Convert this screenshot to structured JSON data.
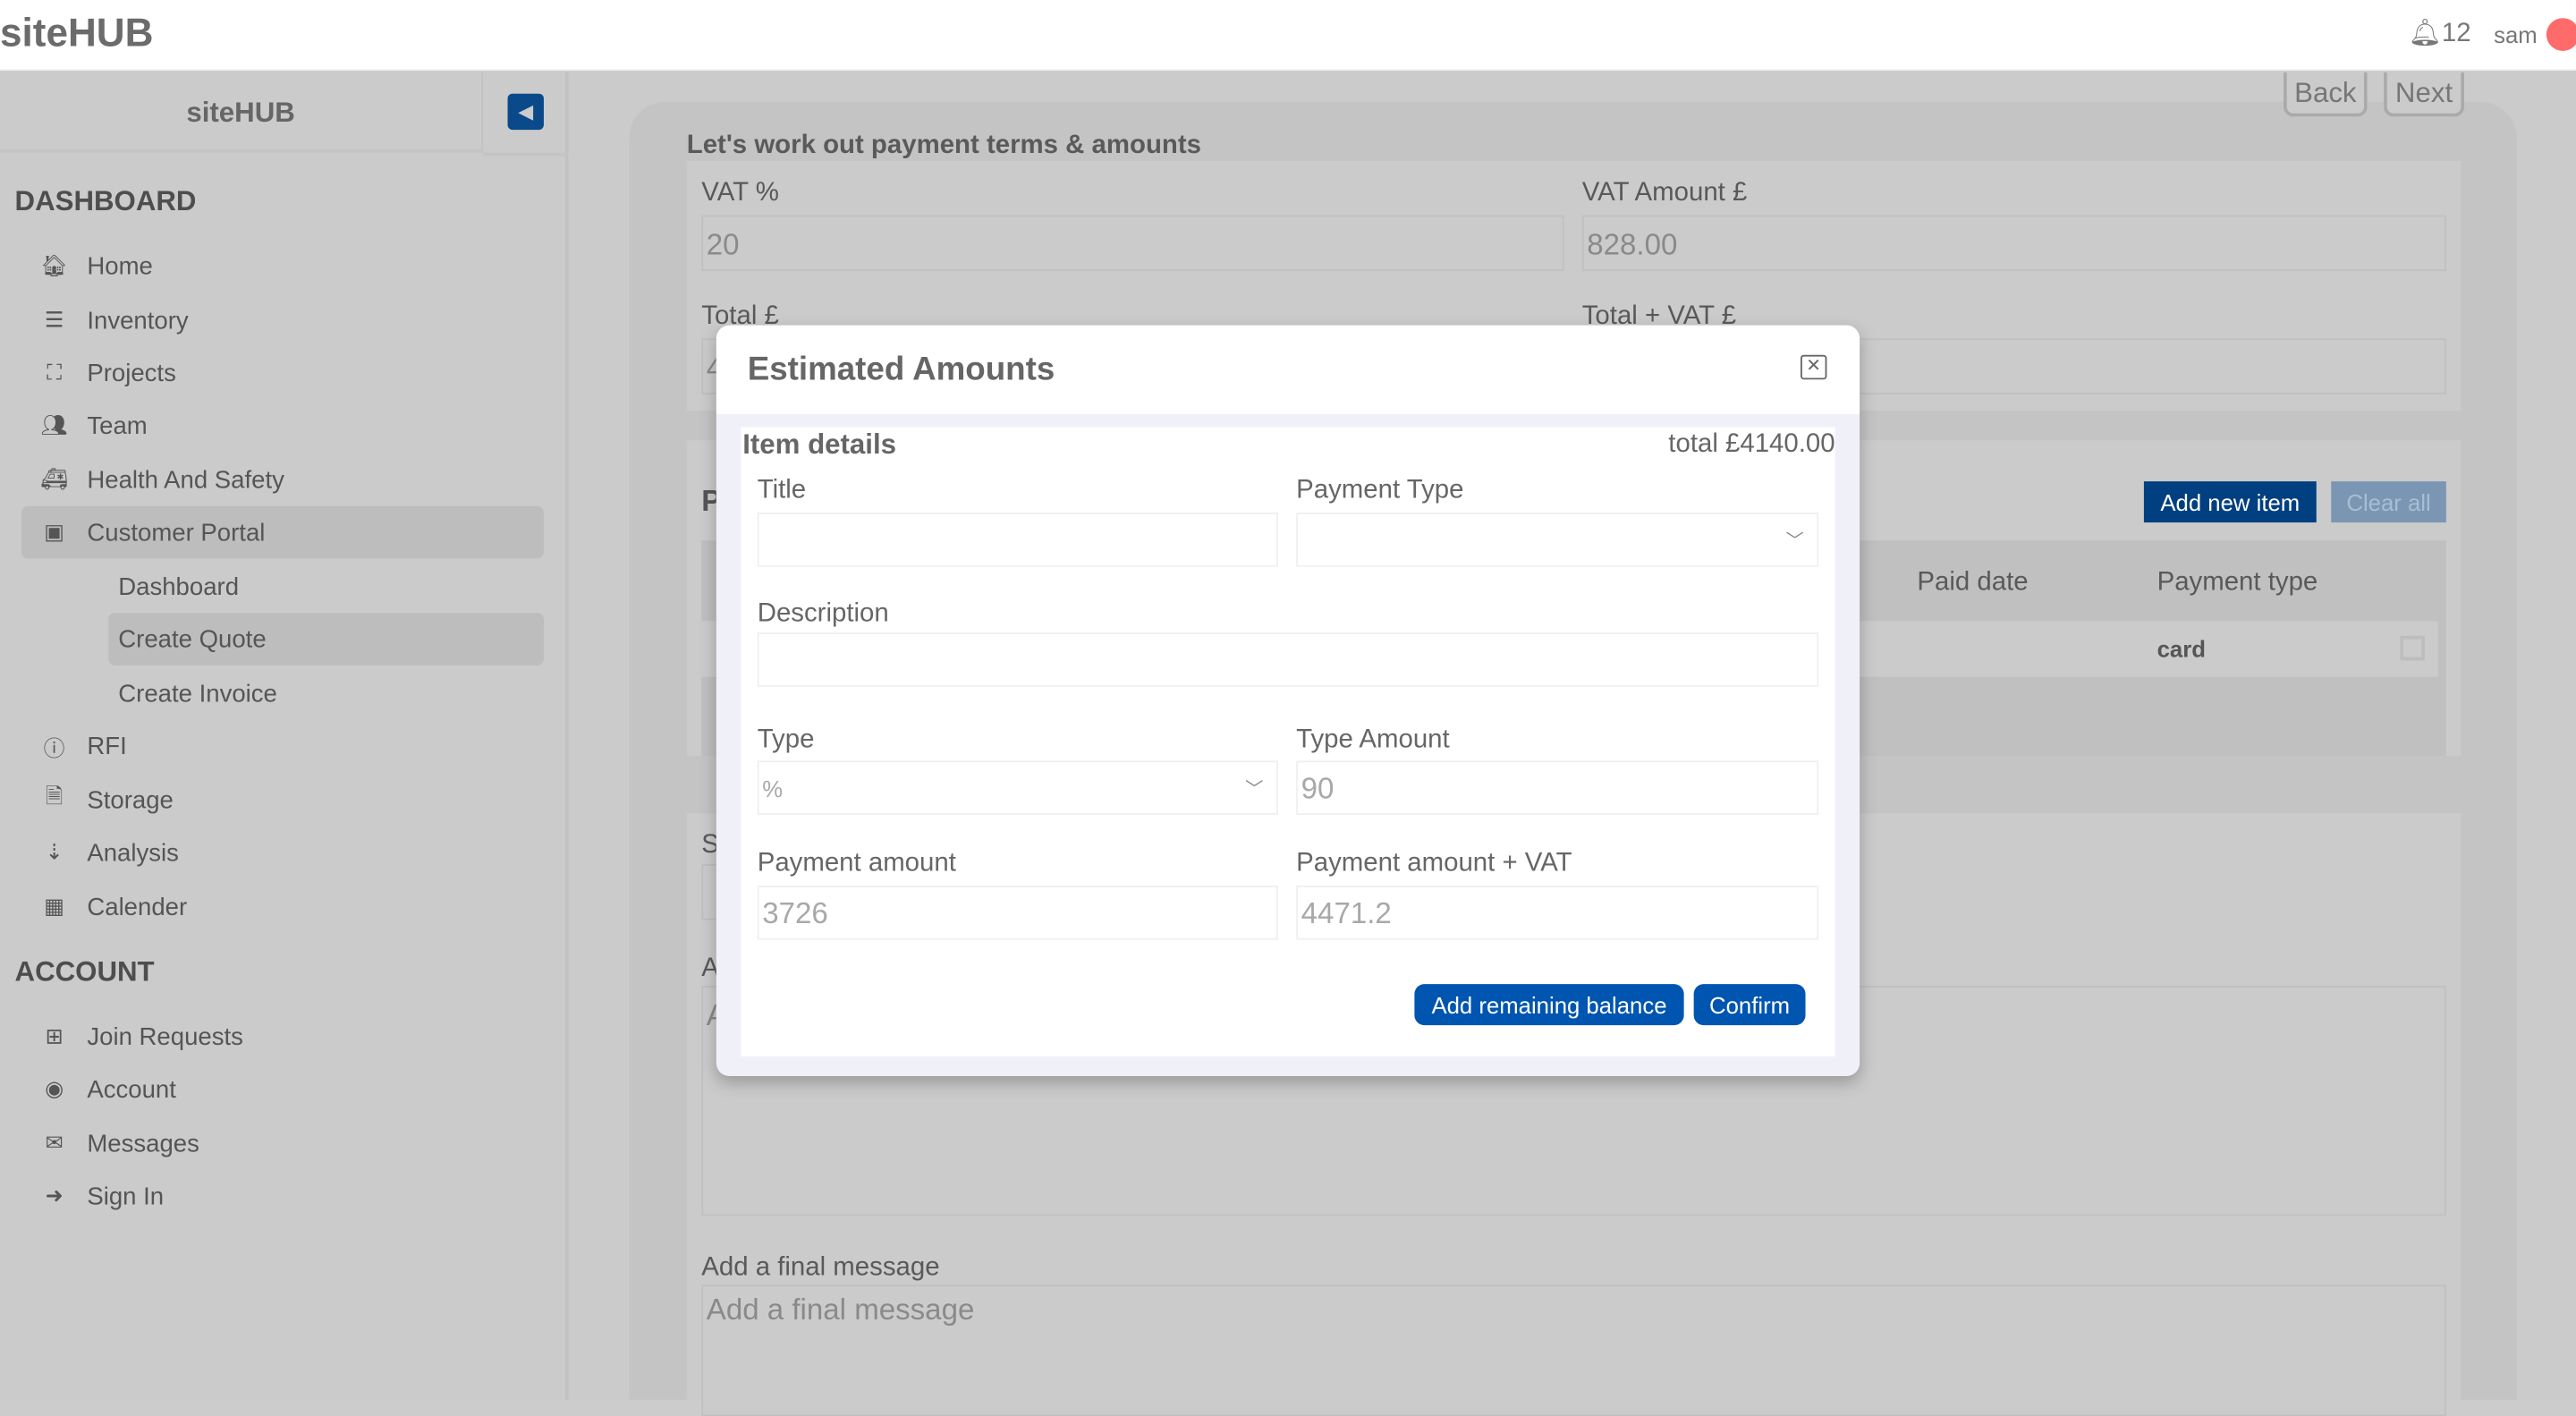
{
  "header": {
    "logo": "siteHUB",
    "notification_count": "12",
    "user": "sam"
  },
  "sidebar": {
    "title": "siteHUB",
    "sections": [
      {
        "label": "DASHBOARD"
      },
      {
        "label": "ACCOUNT"
      }
    ],
    "items": [
      {
        "label": "Home",
        "icon": "home-icon"
      },
      {
        "label": "Inventory",
        "icon": "list-icon"
      },
      {
        "label": "Projects",
        "icon": "sitemap-icon"
      },
      {
        "label": "Team",
        "icon": "users-icon"
      },
      {
        "label": "Health And Safety",
        "icon": "truck-medical-icon"
      },
      {
        "label": "Customer Portal",
        "icon": "portal-icon"
      },
      {
        "label": "Dashboard"
      },
      {
        "label": "Create Quote"
      },
      {
        "label": "Create Invoice"
      },
      {
        "label": "RFI",
        "icon": "info-icon"
      },
      {
        "label": "Storage",
        "icon": "file-icon"
      },
      {
        "label": "Analysis",
        "icon": "sort-icon"
      },
      {
        "label": "Calender",
        "icon": "calendar-icon"
      },
      {
        "label": "Join Requests",
        "icon": "plus-square-icon"
      },
      {
        "label": "Account",
        "icon": "user-circle-icon"
      },
      {
        "label": "Messages",
        "icon": "envelope-icon"
      },
      {
        "label": "Sign In",
        "icon": "sign-in-icon"
      }
    ]
  },
  "main": {
    "back": "Back",
    "next": "Next",
    "title": "Let's work out payment terms & amounts",
    "vat_label": "VAT %",
    "vat_value": "20",
    "vat_amount_label": "VAT Amount £",
    "vat_amount_value": "828.00",
    "total_label": "Total £",
    "total_partial": "4",
    "total_vat_label": "Total + VAT £",
    "section2_partial": "P",
    "add_new_item": "Add new item",
    "clear_all": "Clear all",
    "table": {
      "headers": [
        "Paid date",
        "Payment type"
      ],
      "rows": [
        {
          "payment_type": "card"
        }
      ]
    },
    "s_partial": "S",
    "a_partial": "A",
    "a_placeholder_partial": "A",
    "final_label": "Add a final message",
    "final_placeholder": "Add a final message"
  },
  "modal": {
    "title": "Estimated Amounts",
    "section": "Item details",
    "total": "total £4140.00",
    "title_label": "Title",
    "title_value": "",
    "payment_type_label": "Payment Type",
    "payment_type_value": "",
    "description_label": "Description",
    "description_value": "",
    "type_label": "Type",
    "type_value": "%",
    "type_amount_label": "Type Amount",
    "type_amount_value": "90",
    "payment_amount_label": "Payment amount",
    "payment_amount_value": "3726",
    "payment_vat_label": "Payment amount + VAT",
    "payment_vat_value": "4471.2",
    "add_remaining": "Add remaining balance",
    "confirm": "Confirm"
  },
  "colors": {
    "primary": "#0055b0",
    "avatar": "#ff6b6b"
  }
}
